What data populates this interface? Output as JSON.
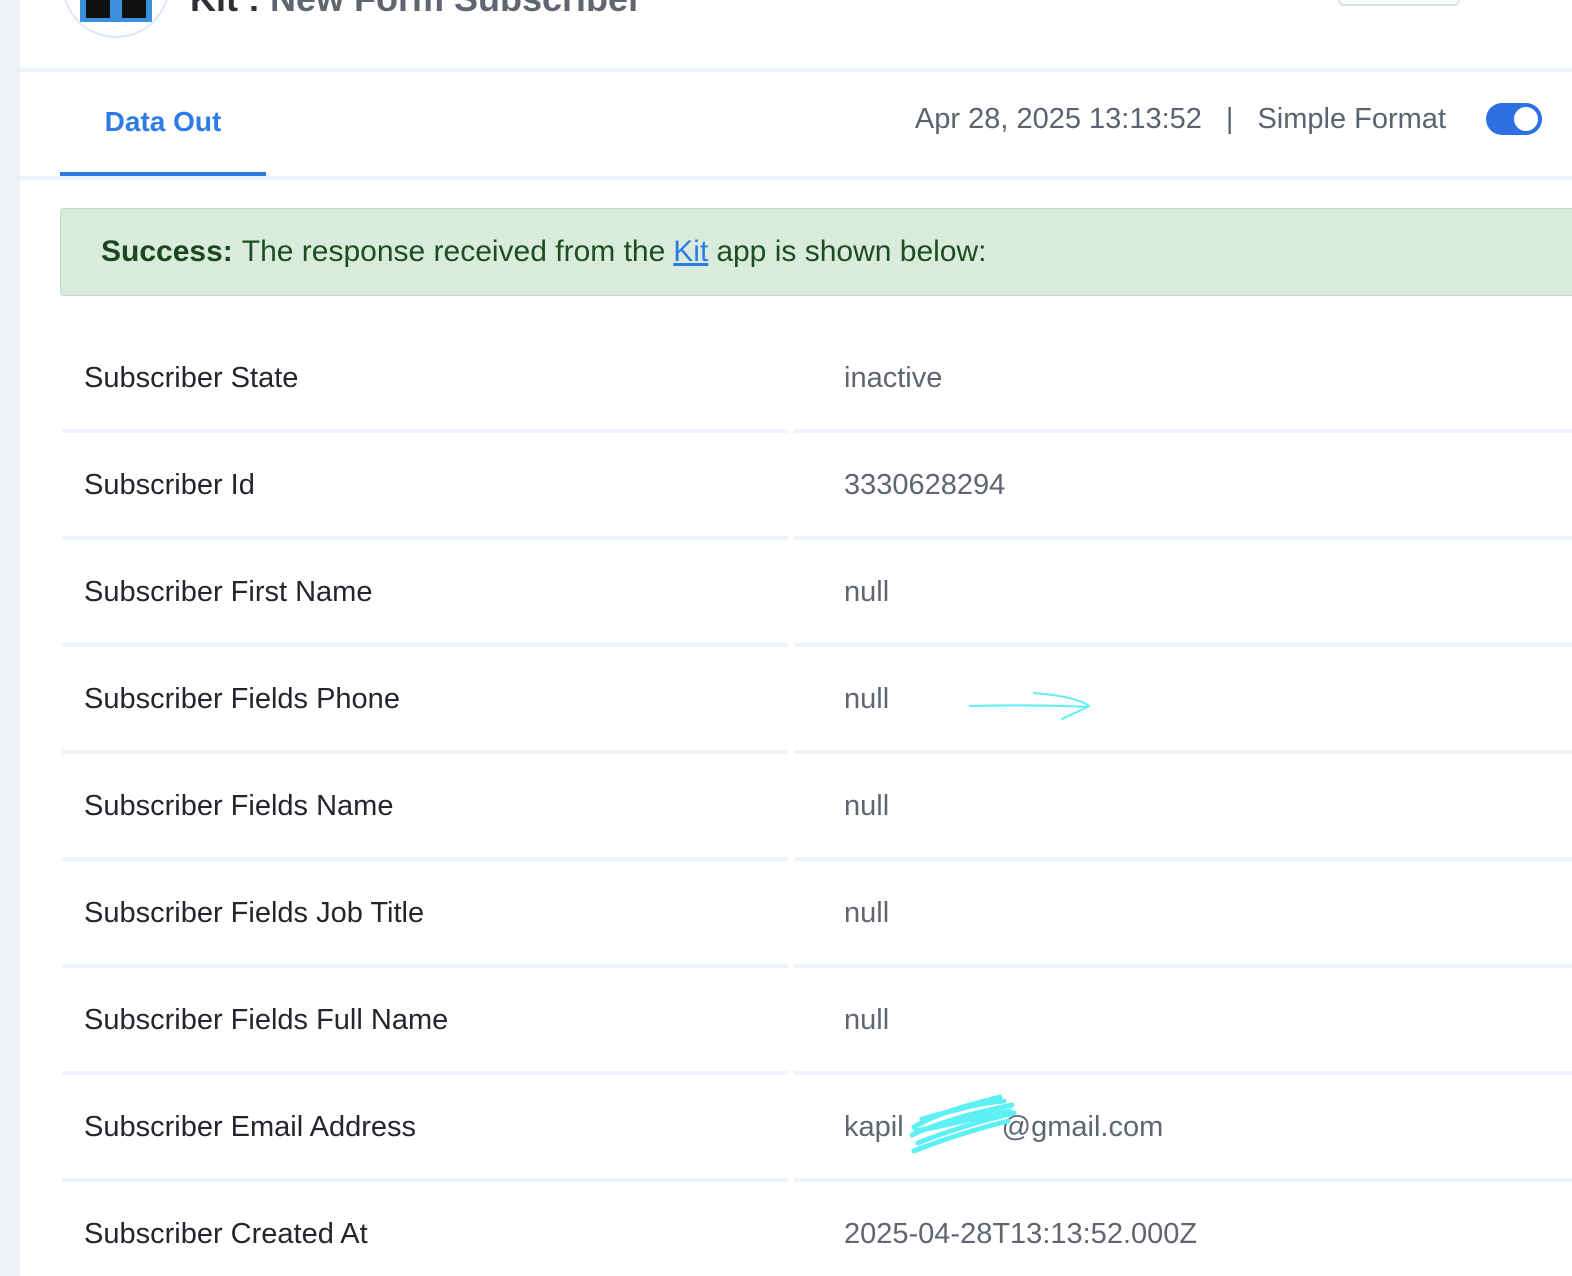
{
  "header": {
    "title_prefix": "Kit : ",
    "title_rest": "New Form Subscriber"
  },
  "tabs": [
    {
      "label": "Data Out",
      "active": true
    }
  ],
  "meta": {
    "timestamp": "Apr 28, 2025 13:13:52",
    "separator": "|",
    "format_label": "Simple Format",
    "simple_format_on": true
  },
  "alert": {
    "strong": "Success:",
    "text_before": "The response received from the",
    "link": "Kit",
    "text_after": "app is shown below:"
  },
  "rows": [
    {
      "key": "Subscriber State",
      "value": "inactive"
    },
    {
      "key": "Subscriber Id",
      "value": "3330628294"
    },
    {
      "key": "Subscriber First Name",
      "value": "null"
    },
    {
      "key": "Subscriber Fields Phone",
      "value": "null"
    },
    {
      "key": "Subscriber Fields Name",
      "value": "null"
    },
    {
      "key": "Subscriber Fields Job Title",
      "value": "null"
    },
    {
      "key": "Subscriber Fields Full Name",
      "value": "null"
    },
    {
      "key": "Subscriber Email Address",
      "value": "kapil",
      "value_suffix": "@gmail.com"
    },
    {
      "key": "Subscriber Created At",
      "value": "2025-04-28T13:13:52.000Z"
    }
  ],
  "colors": {
    "accent": "#2f7be6",
    "success_bg": "#d9ecdb",
    "success_text": "#1e4d24",
    "annotation": "#5ef0f5"
  }
}
